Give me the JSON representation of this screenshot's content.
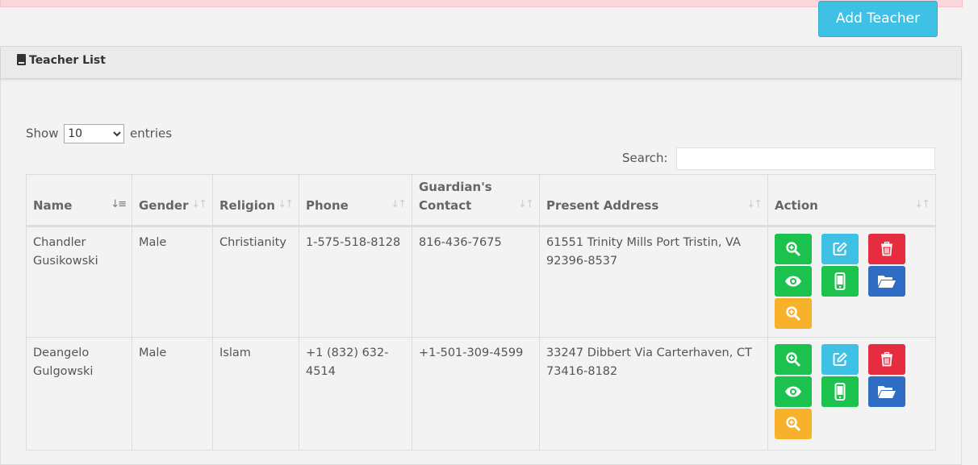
{
  "header": {
    "add_teacher_label": "Add Teacher"
  },
  "panel": {
    "title": "Teacher List"
  },
  "length_menu": {
    "show_label": "Show",
    "selected": "10",
    "options": [
      "10"
    ],
    "entries_label": "entries"
  },
  "search": {
    "label": "Search:",
    "value": ""
  },
  "table": {
    "columns": [
      "Name",
      "Gender",
      "Religion",
      "Phone",
      "Guardian's Contact",
      "Present Address",
      "Action"
    ],
    "sorted_column": "Name",
    "rows": [
      {
        "name": "Chandler Gusikowski",
        "gender": "Male",
        "religion": "Christianity",
        "phone": "1-575-518-8128",
        "guardian": "816-436-7675",
        "address": "61551 Trinity Mills Port Tristin, VA 92396-8537"
      },
      {
        "name": "Deangelo Gulgowski",
        "gender": "Male",
        "religion": "Islam",
        "phone": "+1 (832) 632-4514",
        "guardian": "+1-501-309-4599",
        "address": "33247 Dibbert Via Carterhaven, CT 73416-8182"
      }
    ]
  },
  "action_icons": [
    "zoom-in-icon",
    "edit-icon",
    "trash-icon",
    "eye-icon",
    "mobile-phone-icon",
    "folder-open-icon",
    "zoom-in-icon"
  ],
  "colors": {
    "success": "#1cc24e",
    "info": "#3ec1e4",
    "danger": "#e62d3f",
    "primary": "#2e6dc3",
    "warning": "#f8b12b",
    "alert_bg": "#f9d7dc"
  }
}
